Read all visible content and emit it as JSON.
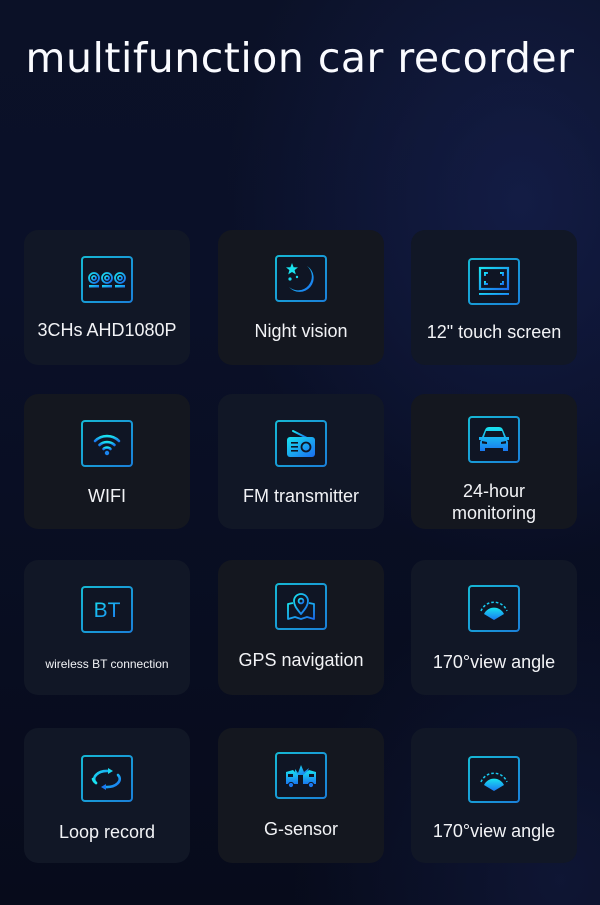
{
  "title": "multifunction car recorder",
  "colors": {
    "accent_start": "#19e0ee",
    "accent_end": "#1a6ff0",
    "card_bg": "#111726",
    "text": "#f2f3f6"
  },
  "features": [
    {
      "label": "3CHs AHD1080P",
      "icon": "three-cameras-icon"
    },
    {
      "label": "Night vision",
      "icon": "moon-stars-icon"
    },
    {
      "label": "12\" touch screen",
      "icon": "touch-screen-icon"
    },
    {
      "label": "WIFI",
      "icon": "wifi-icon"
    },
    {
      "label": "FM transmitter",
      "icon": "radio-icon"
    },
    {
      "label_line1": "24-hour",
      "label_line2": "monitoring",
      "icon": "car-icon"
    },
    {
      "label": "wireless BT connection",
      "icon": "bluetooth-icon",
      "icon_text": "BT"
    },
    {
      "label": "GPS navigation",
      "icon": "map-pin-icon"
    },
    {
      "label": "170°view angle",
      "icon": "view-angle-icon"
    },
    {
      "label": "Loop record",
      "icon": "loop-icon"
    },
    {
      "label": "G-sensor",
      "icon": "collision-icon"
    },
    {
      "label": "170°view angle",
      "icon": "view-angle-icon"
    }
  ]
}
